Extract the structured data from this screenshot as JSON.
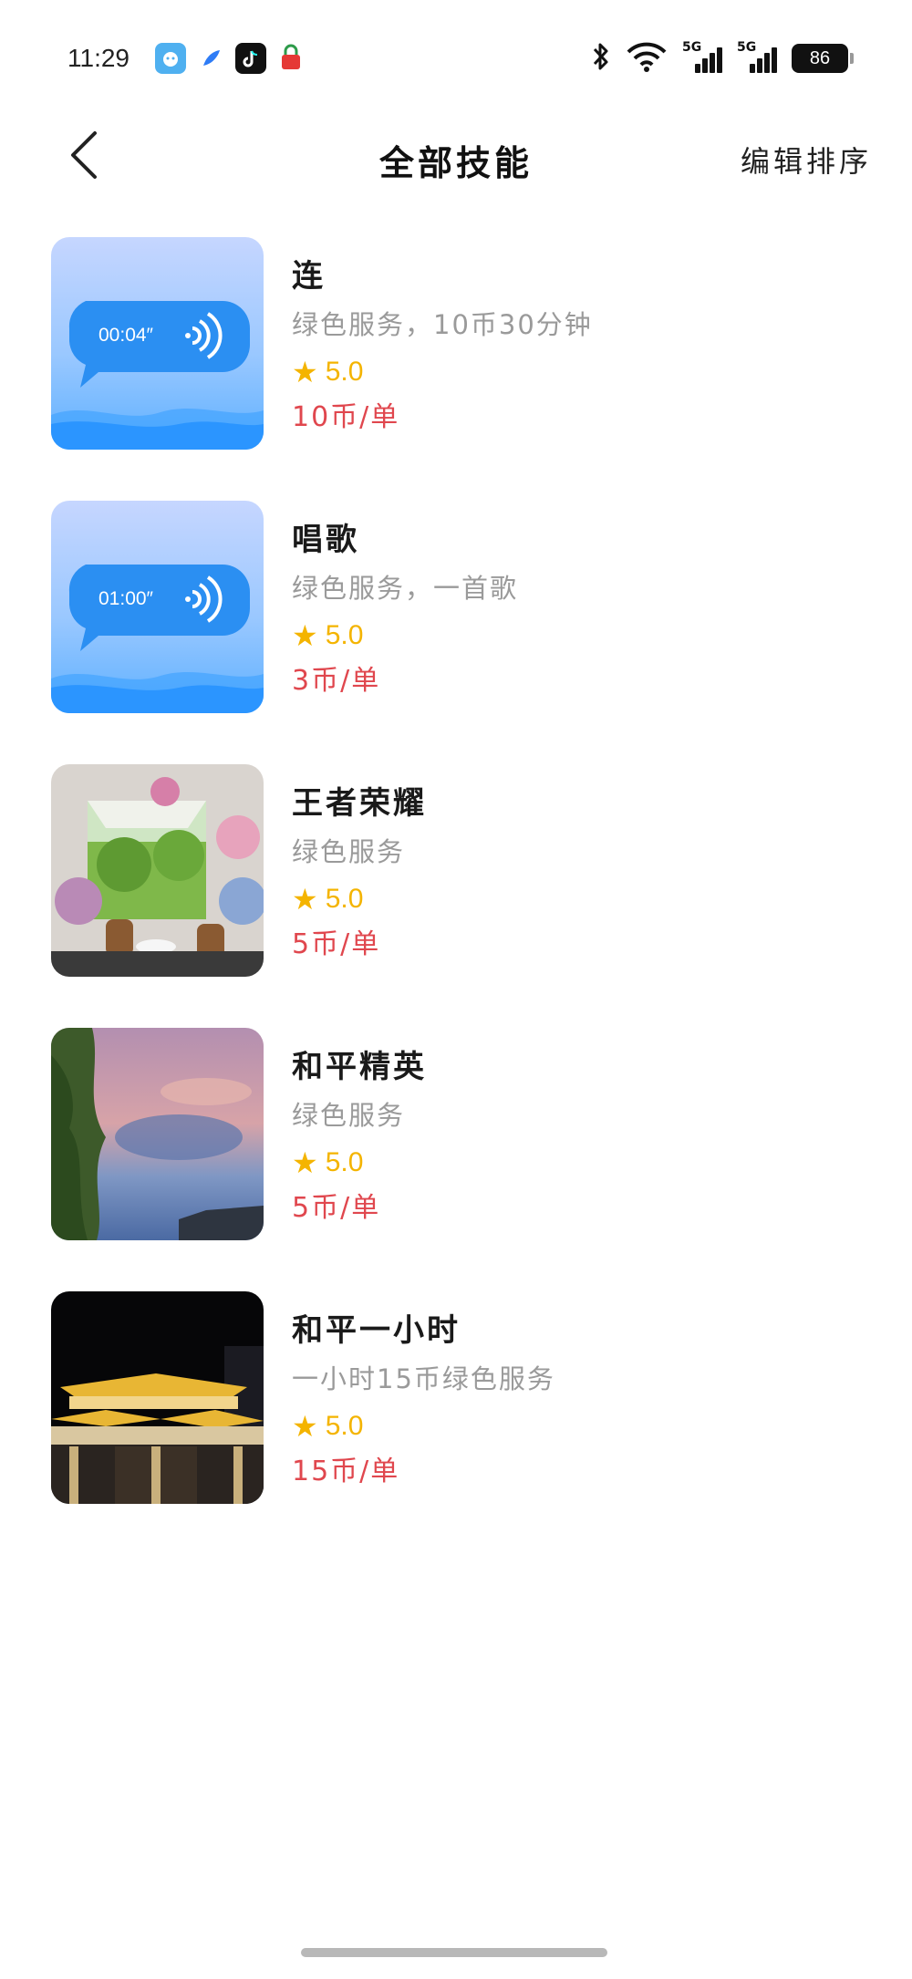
{
  "status_bar": {
    "time": "11:29",
    "network_1": "5G",
    "network_2": "5G",
    "battery": "86",
    "app_icons": [
      "bubble-app-icon",
      "feather-app-icon",
      "tiktok-icon",
      "shopping-app-icon"
    ]
  },
  "nav": {
    "title": "全部技能",
    "sort_label": "编辑排序"
  },
  "skills": [
    {
      "name": "连",
      "description": "绿色服务，10币30分钟",
      "rating": "5.0",
      "price": "10币/单",
      "thumb_type": "voice",
      "duration": "00:04″"
    },
    {
      "name": "唱歌",
      "description": "绿色服务，一首歌",
      "rating": "5.0",
      "price": "3币/单",
      "thumb_type": "voice",
      "duration": "01:00″"
    },
    {
      "name": "王者荣耀",
      "description": "绿色服务",
      "rating": "5.0",
      "price": "5币/单",
      "thumb_type": "photo-garden"
    },
    {
      "name": "和平精英",
      "description": "绿色服务",
      "rating": "5.0",
      "price": "5币/单",
      "thumb_type": "photo-sky"
    },
    {
      "name": "和平一小时",
      "description": "一小时15币绿色服务",
      "rating": "5.0",
      "price": "15币/单",
      "thumb_type": "photo-night"
    }
  ],
  "colors": {
    "star": "#f4b400",
    "price": "#e0474e",
    "description": "#9a9a9a"
  }
}
